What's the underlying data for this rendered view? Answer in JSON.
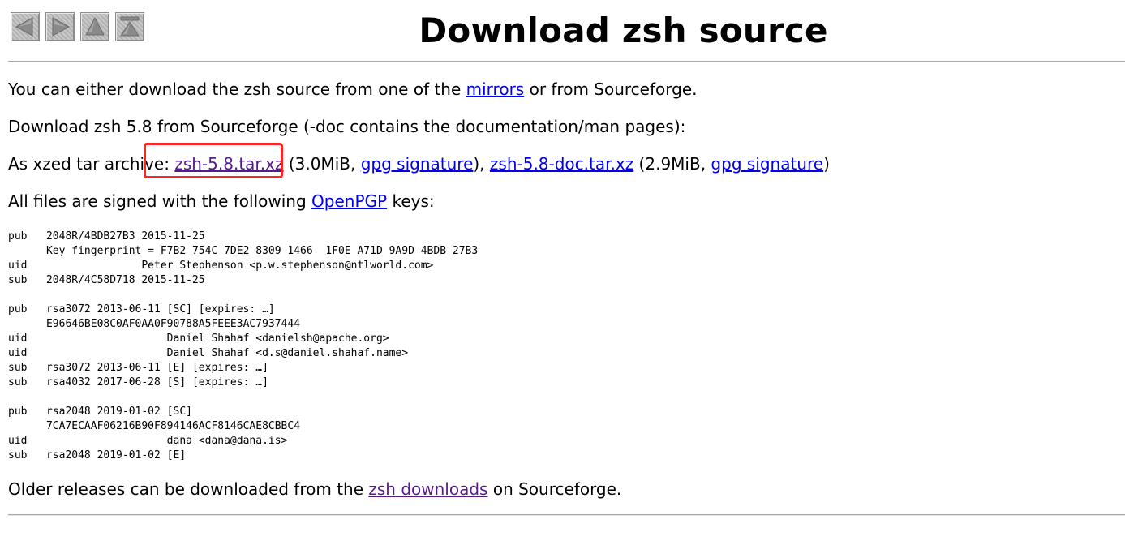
{
  "nav": {
    "buttons": [
      {
        "icon": "arrow-left-icon",
        "label": "Previous"
      },
      {
        "icon": "arrow-right-icon",
        "label": "Next"
      },
      {
        "icon": "arrow-up-icon",
        "label": "Up"
      },
      {
        "icon": "arrow-top-icon",
        "label": "Top"
      }
    ]
  },
  "page": {
    "title": "Download zsh source"
  },
  "intro": {
    "text_before": "You can either download the zsh source from one of the ",
    "mirrors_link": "mirrors",
    "text_after": " or from Sourceforge."
  },
  "download_line": {
    "text": "Download zsh 5.8 from Sourceforge (-doc contains the documentation/man pages):"
  },
  "archive_line": {
    "prefix": "As xzed tar archive: ",
    "file1_link": "zsh-5.8.tar.xz",
    "file1_size": " (3.0MiB, ",
    "sig1_link": "gpg signature",
    "sep": "), ",
    "file2_link": "zsh-5.8-doc.tar.xz",
    "file2_size": " (2.9MiB, ",
    "sig2_link": "gpg signature",
    "end": ")"
  },
  "signed_line": {
    "text_before": "All files are signed with the following ",
    "openpgp_link": "OpenPGP",
    "text_after": " keys:"
  },
  "keys": {
    "block": "pub   2048R/4BDB27B3 2015-11-25\n      Key fingerprint = F7B2 754C 7DE2 8309 1466  1F0E A71D 9A9D 4BDB 27B3\nuid                  Peter Stephenson <p.w.stephenson@ntlworld.com>\nsub   2048R/4C58D718 2015-11-25\n\npub   rsa3072 2013-06-11 [SC] [expires: …]\n      E96646BE08C0AF0AA0F90788A5FEEE3AC7937444\nuid                      Daniel Shahaf <danielsh@apache.org>\nuid                      Daniel Shahaf <d.s@daniel.shahaf.name>\nsub   rsa3072 2013-06-11 [E] [expires: …]\nsub   rsa4032 2017-06-28 [S] [expires: …]\n\npub   rsa2048 2019-01-02 [SC]\n      7CA7ECAAF06216B90F894146ACF8146CAE8CBBC4\nuid                      dana <dana@dana.is>\nsub   rsa2048 2019-01-02 [E]"
  },
  "older_line": {
    "text_before": "Older releases can be downloaded from the ",
    "downloads_link": "zsh downloads",
    "text_after": " on Sourceforge."
  },
  "colors": {
    "link": "#0000ee",
    "visited_link": "#551a8b",
    "highlight_box": "#ff2424"
  }
}
